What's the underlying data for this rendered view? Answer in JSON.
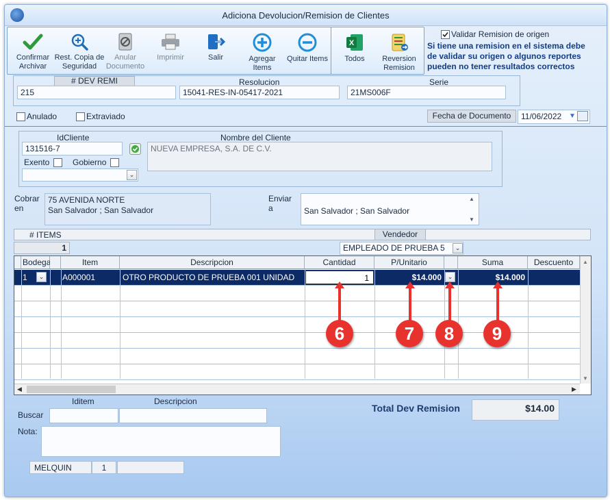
{
  "window": {
    "title": "Adiciona Devolucion/Remision de Clientes"
  },
  "toolbar": {
    "confirm": "Confirmar Archivar",
    "restore": "Rest. Copia de Seguridad",
    "void": "Anular Documento",
    "print": "Imprimir",
    "exit": "Salir",
    "add_items": "Agregar Items",
    "remove_items": "Quitar Items",
    "all": "Todos",
    "reversal": "Reversion Remision"
  },
  "validate": {
    "checkbox_label": "Validar Remision de origen",
    "checked": true,
    "note": "Si tiene una remision en el sistema debe de validar su origen o algunos reportes pueden no tener resultados correctos"
  },
  "header": {
    "dev_remi_label": "# DEV REMI",
    "dev_remi_value": "215",
    "resolucion_label": "Resolucion",
    "resolucion_value": "15041-RES-IN-05417-2021",
    "serie_label": "Serie",
    "serie_value": "21MS006F"
  },
  "status": {
    "anulado_label": "Anulado",
    "extraviado_label": "Extraviado",
    "fecha_label": "Fecha de  Documento",
    "fecha_value": "11/06/2022"
  },
  "client": {
    "id_label": "IdCliente",
    "id_value": "131516-7",
    "name_label": "Nombre del Cliente",
    "name_value": "NUEVA EMPRESA, S.A. DE C.V.",
    "exento_label": "Exento",
    "gobierno_label": "Gobierno"
  },
  "address": {
    "cobrar_label": "Cobrar en",
    "cobrar_line1": "75 AVENIDA NORTE",
    "cobrar_line2": "San Salvador ; San Salvador",
    "enviar_label": "Enviar a",
    "enviar_line1": "San Salvador ; San Salvador"
  },
  "items_bar": {
    "items_label": "# ITEMS",
    "items_count": "1",
    "vendedor_label": "Vendedor",
    "vendedor_value": "EMPLEADO DE PRUEBA 5"
  },
  "grid": {
    "columns": [
      "Bodega",
      "Item",
      "Descripcion",
      "Cantidad",
      "P/Unitario",
      "Suma",
      "Descuento"
    ],
    "columns_display": {
      "bodega": "Bodega",
      "item": "Item",
      "descripcion": "Descripcion",
      "cantidad": "Cantidad",
      "punitario": "P/Unitario",
      "suma": "Suma",
      "descuento": "Descuento"
    },
    "rows": [
      {
        "bodega": "1",
        "item": "A000001",
        "descripcion": "OTRO PRODUCTO DE PRUEBA 001 UNIDAD",
        "cantidad": "1",
        "punitario": "$14.000",
        "suma": "$14.000",
        "descuento": ""
      }
    ]
  },
  "markers": [
    "6",
    "7",
    "8",
    "9"
  ],
  "bottom": {
    "iditem_label": "Iditem",
    "descripcion_label": "Descripcion",
    "buscar_label": "Buscar",
    "nota_label": "Nota:",
    "total_label": "Total Dev Remision",
    "total_value": "$14.00",
    "status_user": "MELQUIN",
    "status_num": "1"
  },
  "colors": {
    "selection": "#0b2a66",
    "marker": "#e8322d",
    "window_gradient_bottom": "#a9c9f0"
  }
}
